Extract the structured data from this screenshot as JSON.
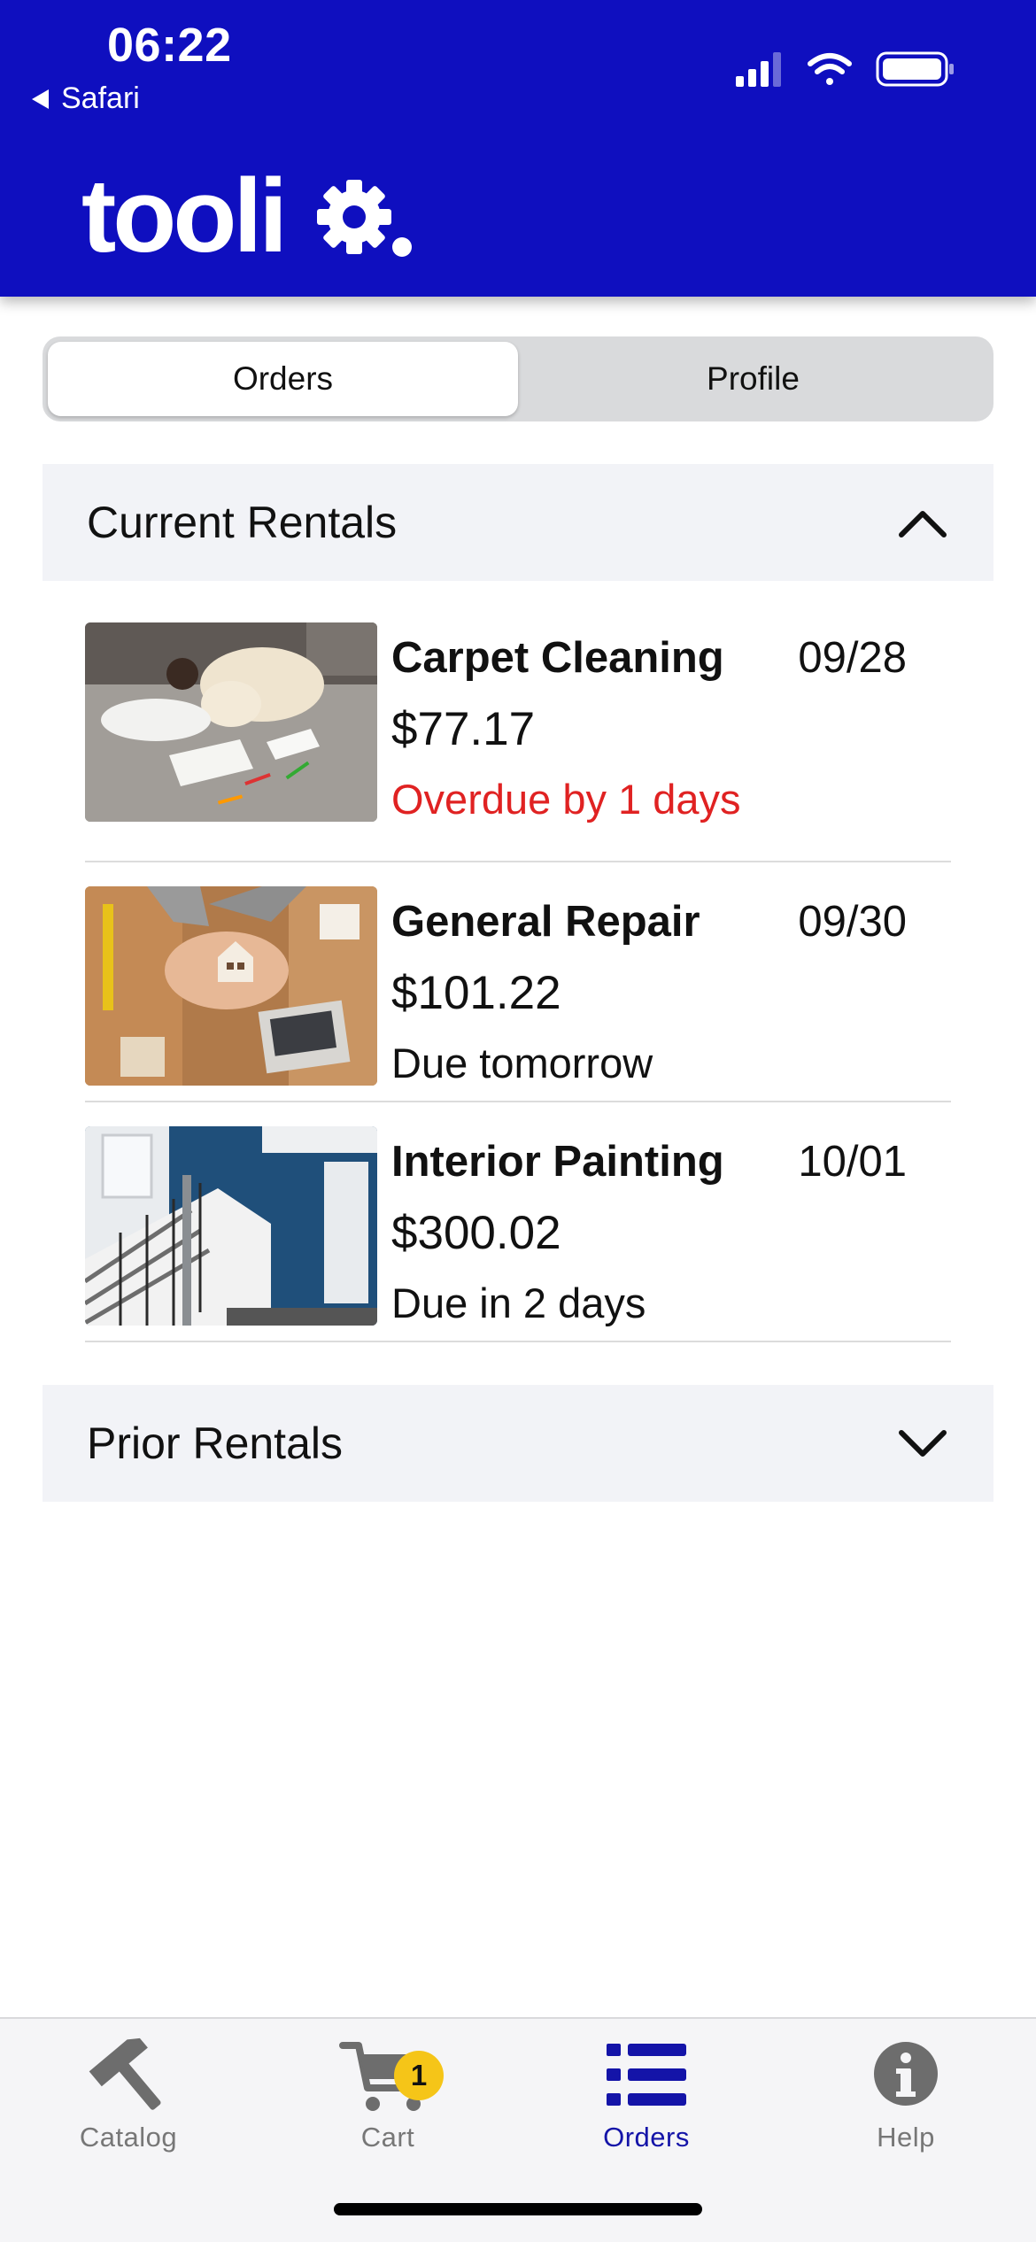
{
  "status_bar": {
    "time": "06:22",
    "back_app": "Safari",
    "icons": [
      "signal-icon",
      "wifi-icon",
      "battery-icon"
    ]
  },
  "brand": {
    "logo_text": "toolio.",
    "header_color": "#0f0fbf",
    "accent_color": "#1414a8"
  },
  "segmented": {
    "tabs": [
      {
        "label": "Orders",
        "active": true
      },
      {
        "label": "Profile",
        "active": false
      }
    ]
  },
  "current_rentals": {
    "title": "Current Rentals",
    "expanded": true,
    "items": [
      {
        "title": "Carpet Cleaning",
        "date": "09/28",
        "price": "$77.17",
        "status": "Overdue by 1 days",
        "overdue": true,
        "image": "girl-and-dog-on-carpet-image"
      },
      {
        "title": "General Repair",
        "date": "09/30",
        "price": "$101.22",
        "status": "Due tomorrow",
        "overdue": false,
        "image": "hands-holding-house-image"
      },
      {
        "title": "Interior Painting",
        "date": "10/01",
        "price": "$300.02",
        "status": "Due in 2 days",
        "overdue": false,
        "image": "blue-staircase-wall-image"
      }
    ]
  },
  "prior_rentals": {
    "title": "Prior Rentals",
    "expanded": false
  },
  "tabbar": {
    "items": [
      {
        "label": "Catalog",
        "icon": "hammer-icon",
        "active": false
      },
      {
        "label": "Cart",
        "icon": "cart-icon",
        "active": false,
        "badge": "1"
      },
      {
        "label": "Orders",
        "icon": "list-icon",
        "active": true
      },
      {
        "label": "Help",
        "icon": "info-icon",
        "active": false
      }
    ]
  }
}
